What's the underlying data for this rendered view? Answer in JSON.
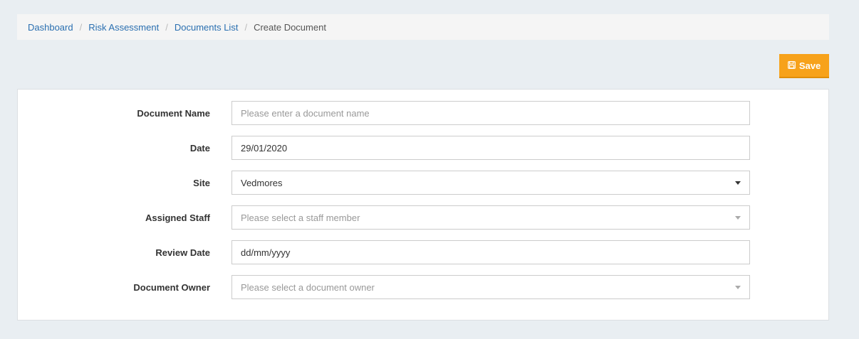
{
  "breadcrumb": {
    "items": [
      "Dashboard",
      "Risk Assessment",
      "Documents List"
    ],
    "active": "Create Document",
    "separator": "/"
  },
  "toolbar": {
    "save_label": "Save",
    "save_icon": "floppy-disk-icon"
  },
  "form": {
    "document_name": {
      "label": "Document Name",
      "value": "",
      "placeholder": "Please enter a document name"
    },
    "date": {
      "label": "Date",
      "value": "29/01/2020"
    },
    "site": {
      "label": "Site",
      "value": "Vedmores"
    },
    "assigned_staff": {
      "label": "Assigned Staff",
      "placeholder": "Please select a staff member"
    },
    "review_date": {
      "label": "Review Date",
      "value": "dd/mm/yyyy"
    },
    "document_owner": {
      "label": "Document Owner",
      "placeholder": "Please select a document owner"
    }
  },
  "colors": {
    "page_bg": "#e9eef2",
    "link": "#2a6fb0",
    "save_button": "#f7a21b"
  }
}
